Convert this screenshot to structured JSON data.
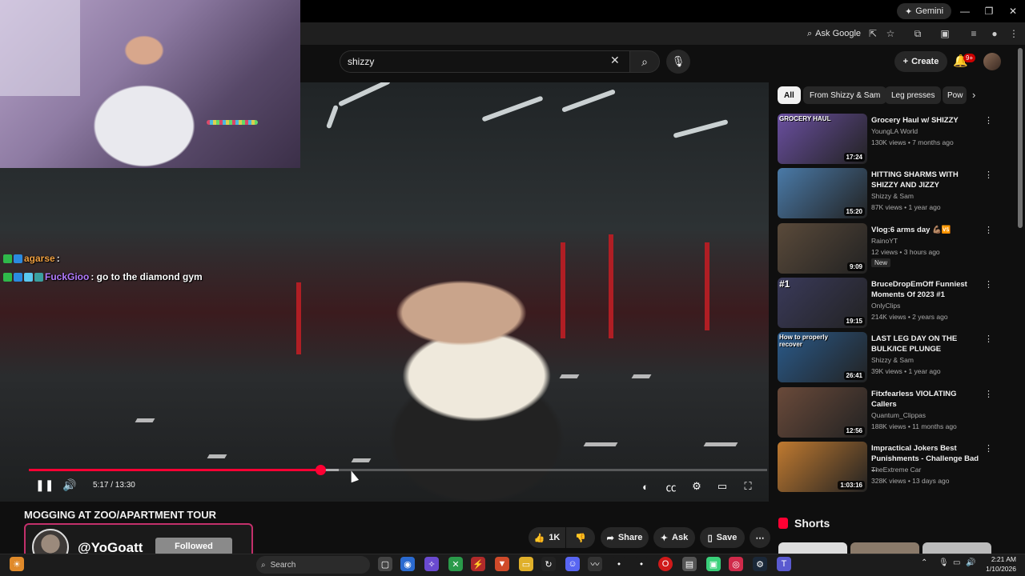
{
  "browser": {
    "gemini_label": "Gemini",
    "window_controls": [
      "—",
      "❐",
      "✕"
    ],
    "ask_google_label": "Ask Google"
  },
  "youtube_header": {
    "search_value": "shizzy",
    "create_label": "Create",
    "notification_count": "9+"
  },
  "player": {
    "time_display": "5:17 / 13:30",
    "progress_fraction": 0.395,
    "buffered_fraction": 0.42,
    "title": "MOGGING AT ZOO/APARTMENT TOUR"
  },
  "actions": {
    "like_count": "1K",
    "share_label": "Share",
    "ask_label": "Ask",
    "save_label": "Save"
  },
  "stream_chat": [
    {
      "user": "agarse",
      "message": ":"
    },
    {
      "user": "FuckGioo",
      "message": ": go to the diamond gym"
    }
  ],
  "follow_overlay": {
    "name": "@YoGoatt",
    "button_label": "Followed"
  },
  "chips": [
    "All",
    "From Shizzy & Sam",
    "Leg presses",
    "Pow"
  ],
  "recommendations": [
    {
      "title": "Grocery Haul w/ SHIZZY",
      "channel": "YoungLA World",
      "meta": "130K views • 7 months ago",
      "duration": "17:24",
      "thumb_text": "GROCERY HAUL",
      "thumb_color": "#6a4fa0",
      "is_new": false
    },
    {
      "title": "HITTING SHARMS WITH SHIZZY AND JIZZY",
      "channel": "Shizzy & Sam",
      "meta": "87K views • 1 year ago",
      "duration": "15:20",
      "thumb_text": "",
      "thumb_color": "#4a7aa8",
      "is_new": false
    },
    {
      "title": "Vlog:6 arms day 💪🏽🆚",
      "channel": "RainoYT",
      "meta": "12 views • 3 hours ago",
      "duration": "9:09",
      "thumb_text": "",
      "thumb_color": "#5a4a3a",
      "is_new": true,
      "new_label": "New"
    },
    {
      "title": "BruceDropEmOff Funniest Moments Of 2023 #1",
      "channel": "OnlyClips",
      "meta": "214K views • 2 years ago",
      "duration": "19:15",
      "thumb_text": "#1",
      "thumb_color": "#3a3a5a",
      "is_new": false
    },
    {
      "title": "LAST LEG DAY ON THE BULK/ICE PLUNGE",
      "channel": "Shizzy & Sam",
      "meta": "39K views • 1 year ago",
      "duration": "26:41",
      "thumb_text": "How to properly recover",
      "thumb_color": "#2a5a8a",
      "is_new": false
    },
    {
      "title": "Fitxfearless VIOLATING Callers",
      "channel": "Quantum_Clippas",
      "meta": "188K views • 11 months ago",
      "duration": "12:56",
      "thumb_text": "",
      "thumb_color": "#6a4a3a",
      "is_new": false
    },
    {
      "title": "Impractical Jokers Best Punishments - Challenge Bad ...",
      "channel": "TheExtreme Car",
      "meta": "328K views • 13 days ago",
      "duration": "1:03:16",
      "thumb_text": "",
      "thumb_color": "#c07a30",
      "is_new": false
    }
  ],
  "shorts": {
    "label": "Shorts"
  },
  "taskbar": {
    "search_label": "Search",
    "time": "2:21 AM",
    "date": "1/10/2026"
  },
  "colors": {
    "accent_red": "#ff0033",
    "background": "#0f0f0f",
    "follow_border": "#c3306b"
  }
}
